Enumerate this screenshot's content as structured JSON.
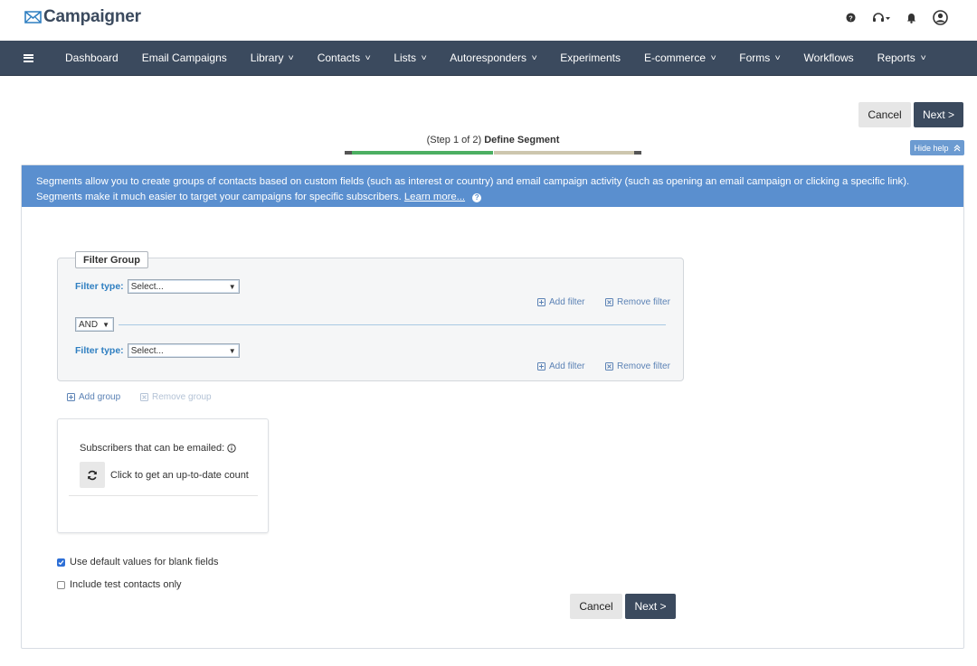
{
  "header": {
    "brand": "Campaigner",
    "icons": [
      "help-icon",
      "headset-icon",
      "bell-icon",
      "user-avatar-icon"
    ]
  },
  "nav": {
    "items": [
      {
        "label": "Dashboard",
        "dropdown": false
      },
      {
        "label": "Email Campaigns",
        "dropdown": false
      },
      {
        "label": "Library",
        "dropdown": true
      },
      {
        "label": "Contacts",
        "dropdown": true
      },
      {
        "label": "Lists",
        "dropdown": true
      },
      {
        "label": "Autoresponders",
        "dropdown": true
      },
      {
        "label": "Experiments",
        "dropdown": false
      },
      {
        "label": "E-commerce",
        "dropdown": true
      },
      {
        "label": "Forms",
        "dropdown": true
      },
      {
        "label": "Workflows",
        "dropdown": false
      },
      {
        "label": "Reports",
        "dropdown": true
      }
    ]
  },
  "actions": {
    "cancel": "Cancel",
    "next": "Next >"
  },
  "step": {
    "prefix": "(Step 1 of 2)",
    "title": "Define Segment",
    "current": 1,
    "total": 2
  },
  "hide_help": "Hide help",
  "help": {
    "line1": "Segments allow you to create groups of contacts based on custom fields (such as interest or country) and email campaign activity (such as opening an email campaign or clicking a specific link).",
    "line2": "Segments make it much easier to target your campaigns for specific subscribers.",
    "learn_more": "Learn more..."
  },
  "filter_group": {
    "legend": "Filter Group",
    "filter_type_label": "Filter type:",
    "select_placeholder": "Select...",
    "operator": "AND",
    "add_filter": "Add filter",
    "remove_filter": "Remove filter"
  },
  "group_actions": {
    "add_group": "Add group",
    "remove_group": "Remove group"
  },
  "subscribers": {
    "title": "Subscribers that can be emailed:",
    "count_prompt": "Click to get an up-to-date count"
  },
  "options": {
    "use_default": {
      "label": "Use default values for blank fields",
      "checked": true
    },
    "test_only": {
      "label": "Include test contacts only",
      "checked": false
    }
  },
  "colors": {
    "nav_bg": "#3b4a5e",
    "banner_bg": "#5a8fcf",
    "progress_done": "#4caf62",
    "progress_todo": "#cdc6ae",
    "link": "#2f7fc1"
  }
}
